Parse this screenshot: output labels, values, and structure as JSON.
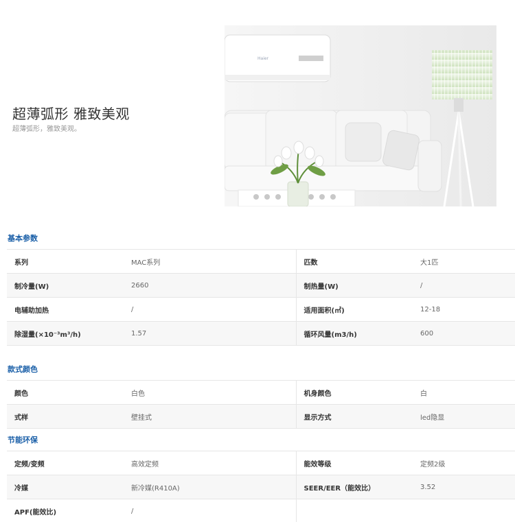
{
  "hero": {
    "title": "超薄弧形 雅致美观",
    "subtitle": "超薄弧形，雅致美观。",
    "ac_logo": "Haier"
  },
  "sections": [
    {
      "title": "基本参数",
      "rows": [
        {
          "k1": "系列",
          "v1": "MAC系列",
          "k2": "匹数",
          "v2": "大1匹"
        },
        {
          "k1": "制冷量(W)",
          "v1": "2660",
          "k2": "制热量(W)",
          "v2": "/"
        },
        {
          "k1": "电辅助加热",
          "v1": "/",
          "k2": "适用面积(㎡)",
          "v2": "12-18"
        },
        {
          "k1": "除湿量(×10⁻³m³/h)",
          "v1": "1.57",
          "k2": "循环风量(m3/h)",
          "v2": "600"
        }
      ]
    },
    {
      "title": "款式颜色",
      "rows": [
        {
          "k1": "颜色",
          "v1": "白色",
          "k2": "机身颜色",
          "v2": "白"
        },
        {
          "k1": "式样",
          "v1": "壁挂式",
          "k2": "显示方式",
          "v2": "led隐显"
        }
      ]
    },
    {
      "title": "节能环保",
      "rows": [
        {
          "k1": "定频/变频",
          "v1": "高效定频",
          "k2": "能效等级",
          "v2": "定频2级"
        },
        {
          "k1": "冷媒",
          "v1": "新冷媒(R410A)",
          "k2": "SEER/EER（能效比）",
          "v2": "3.52"
        },
        {
          "k1": "APF(能效比)",
          "v1": "/",
          "k2": "",
          "v2": ""
        }
      ]
    }
  ]
}
